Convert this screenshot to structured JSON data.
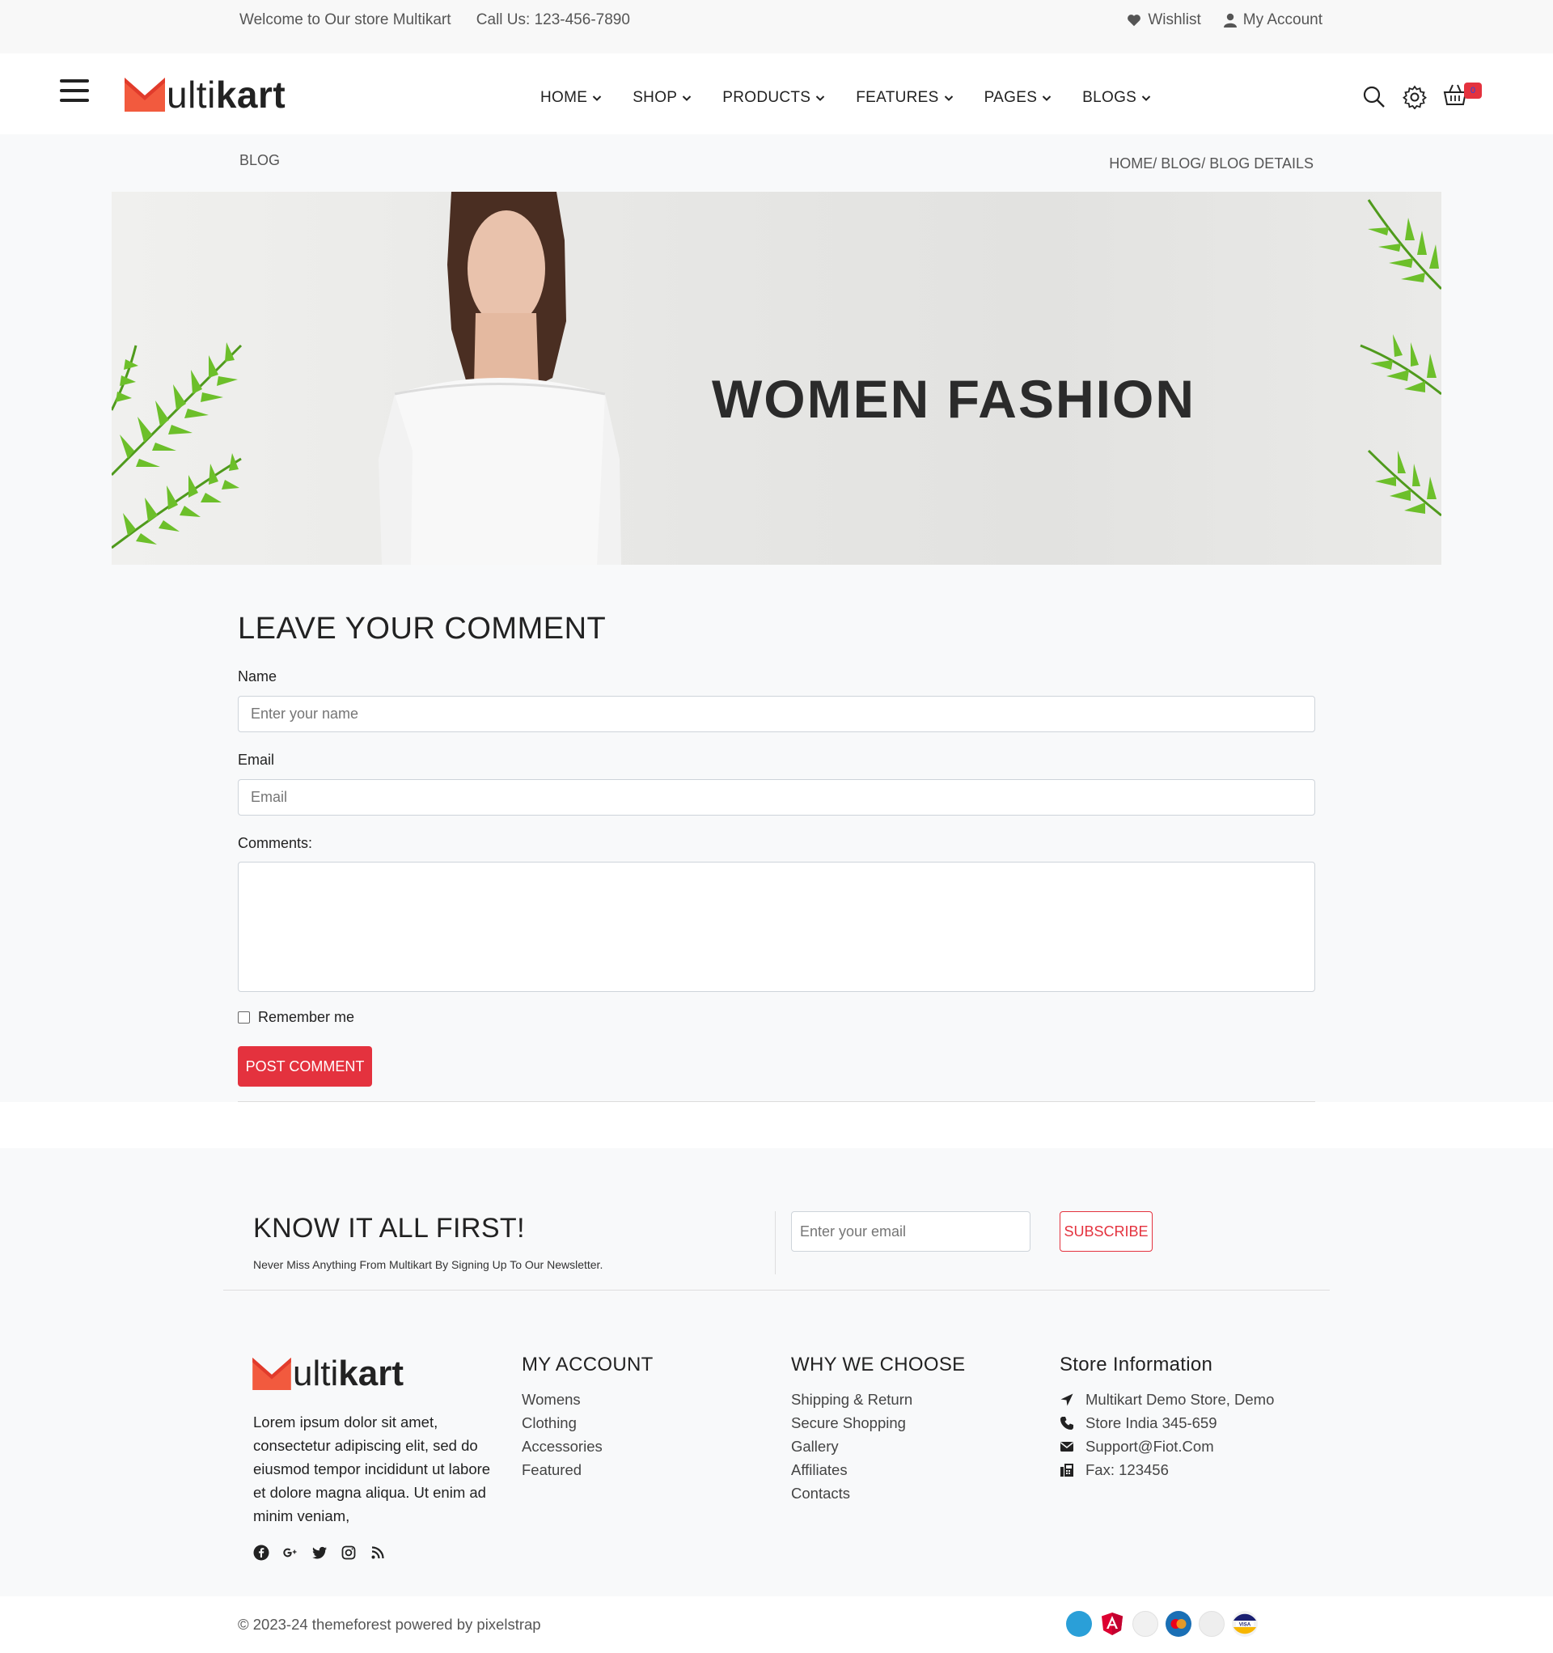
{
  "topbar": {
    "welcome": "Welcome to Our store Multikart",
    "phone": "Call Us: 123-456-7890",
    "wishlist": "Wishlist",
    "account": "My Account"
  },
  "header": {
    "logo_m": "M",
    "logo_rest_light": "ulti",
    "logo_rest_bold": "kart",
    "nav": [
      {
        "label": "HOME"
      },
      {
        "label": "SHOP"
      },
      {
        "label": "PRODUCTS"
      },
      {
        "label": "FEATURES"
      },
      {
        "label": "PAGES"
      },
      {
        "label": "BLOGS"
      }
    ],
    "cart_count": "0"
  },
  "breadcrumb": {
    "title": "BLOG",
    "path": "HOME/ BLOG/ BLOG DETAILS"
  },
  "banner": {
    "headline": "WOMEN FASHION"
  },
  "comment_form": {
    "title": "LEAVE YOUR COMMENT",
    "name_label": "Name",
    "name_placeholder": "Enter your name",
    "email_label": "Email",
    "email_placeholder": "Email",
    "comments_label": "Comments:",
    "remember_label": "Remember me",
    "submit_label": "POST COMMENT"
  },
  "newsletter": {
    "title": "KNOW IT ALL FIRST!",
    "subtitle": "Never Miss Anything From Multikart By Signing Up To Our Newsletter.",
    "email_placeholder": "Enter your email",
    "subscribe_label": "SUBSCRIBE"
  },
  "footer": {
    "about": "Lorem ipsum dolor sit amet, consectetur adipiscing elit, sed do eiusmod tempor incididunt ut labore et dolore magna aliqua. Ut enim ad minim veniam,",
    "social_icons": [
      "facebook-icon",
      "google-plus-icon",
      "twitter-icon",
      "instagram-icon",
      "rss-icon"
    ],
    "my_account": {
      "title": "MY ACCOUNT",
      "items": [
        "Womens",
        "Clothing",
        "Accessories",
        "Featured"
      ]
    },
    "why_we_choose": {
      "title": "WHY WE CHOOSE",
      "items": [
        "Shipping & Return",
        "Secure Shopping",
        "Gallery",
        "Affiliates",
        "Contacts"
      ]
    },
    "store_info": {
      "title": "Store Information",
      "address": "Multikart Demo Store, Demo",
      "phone": "Store India 345-659",
      "email": "Support@Fiot.Com",
      "fax": "Fax: 123456"
    },
    "copyright": "© 2023-24 themeforest powered by pixelstrap",
    "payment_icons": [
      "american-express-icon",
      "angular-icon",
      "discover-icon",
      "mastercard-icon",
      "paypal-icon",
      "visa-icon"
    ]
  },
  "colors": {
    "accent": "#e4323e",
    "text": "#222222",
    "muted": "#555555",
    "background_light": "#f8f9fa"
  }
}
